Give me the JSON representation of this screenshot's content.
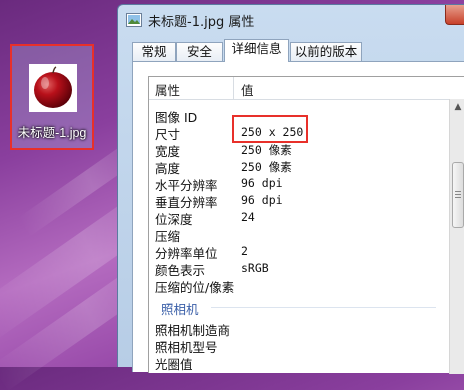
{
  "desktop": {
    "icon_label": "未标题-1.jpg"
  },
  "window": {
    "title": "未标题-1.jpg 属性",
    "tabs": [
      "常规",
      "安全",
      "详细信息",
      "以前的版本"
    ],
    "active_tab": "详细信息"
  },
  "details": {
    "col_property": "属性",
    "col_value": "值",
    "rows": [
      {
        "k": "图像 ID",
        "v": ""
      },
      {
        "k": "尺寸",
        "v": "250 x 250"
      },
      {
        "k": "宽度",
        "v": "250 像素"
      },
      {
        "k": "高度",
        "v": "250 像素"
      },
      {
        "k": "水平分辨率",
        "v": "96 dpi"
      },
      {
        "k": "垂直分辨率",
        "v": "96 dpi"
      },
      {
        "k": "位深度",
        "v": "24"
      },
      {
        "k": "压缩",
        "v": ""
      },
      {
        "k": "分辨率单位",
        "v": "2"
      },
      {
        "k": "颜色表示",
        "v": "sRGB"
      },
      {
        "k": "压缩的位/像素",
        "v": ""
      }
    ],
    "group_camera": "照相机",
    "camera_rows": [
      {
        "k": "照相机制造商",
        "v": ""
      },
      {
        "k": "照相机型号",
        "v": ""
      },
      {
        "k": "光圈值",
        "v": ""
      }
    ]
  },
  "icons": {
    "thumbnail": "red-apple-image",
    "window_icon": "image-file-icon",
    "close": "close-icon"
  },
  "colors": {
    "highlight": "#e8302a",
    "group_text": "#3a5fa8"
  }
}
